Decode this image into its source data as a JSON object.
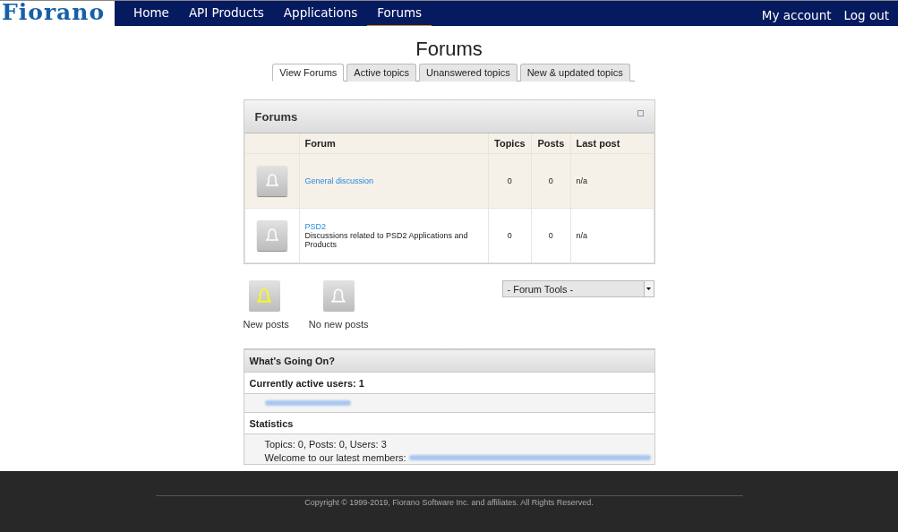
{
  "logo": "Fiorano",
  "nav": [
    {
      "label": "Home",
      "selected": false
    },
    {
      "label": "API Products",
      "selected": false
    },
    {
      "label": "Applications",
      "selected": false
    },
    {
      "label": "Forums",
      "selected": true
    }
  ],
  "account_links": [
    "My account",
    "Log out"
  ],
  "page_title": "Forums",
  "tabs": [
    {
      "label": "View Forums",
      "selected": true
    },
    {
      "label": "Active topics",
      "selected": false
    },
    {
      "label": "Unanswered topics",
      "selected": false
    },
    {
      "label": "New & updated topics",
      "selected": false
    }
  ],
  "forums_panel": {
    "title": "Forums",
    "columns": [
      "Forum",
      "Topics",
      "Posts",
      "Last post"
    ],
    "rows": [
      {
        "name": "General discussion",
        "description": "",
        "topics": "0",
        "posts": "0",
        "last_post": "n/a",
        "highlighted": true
      },
      {
        "name": "PSD2",
        "description": "Discussions related to PSD2 Applications and Products",
        "topics": "0",
        "posts": "0",
        "last_post": "n/a",
        "highlighted": false
      }
    ]
  },
  "legend": [
    {
      "label": "New posts",
      "new": true
    },
    {
      "label": "No new posts",
      "new": false
    }
  ],
  "forum_tools": {
    "value": "- Forum Tools -"
  },
  "whats_going_on": {
    "title": "What's Going On?",
    "active_users": "Currently active users: 1",
    "statistics_title": "Statistics",
    "stats": "Topics: 0, Posts: 0, Users: 3",
    "welcome": "Welcome to our latest members:"
  },
  "footer": "Copyright © 1999-2019, Fiorano Software Inc. and affiliates. All Rights Reserved."
}
